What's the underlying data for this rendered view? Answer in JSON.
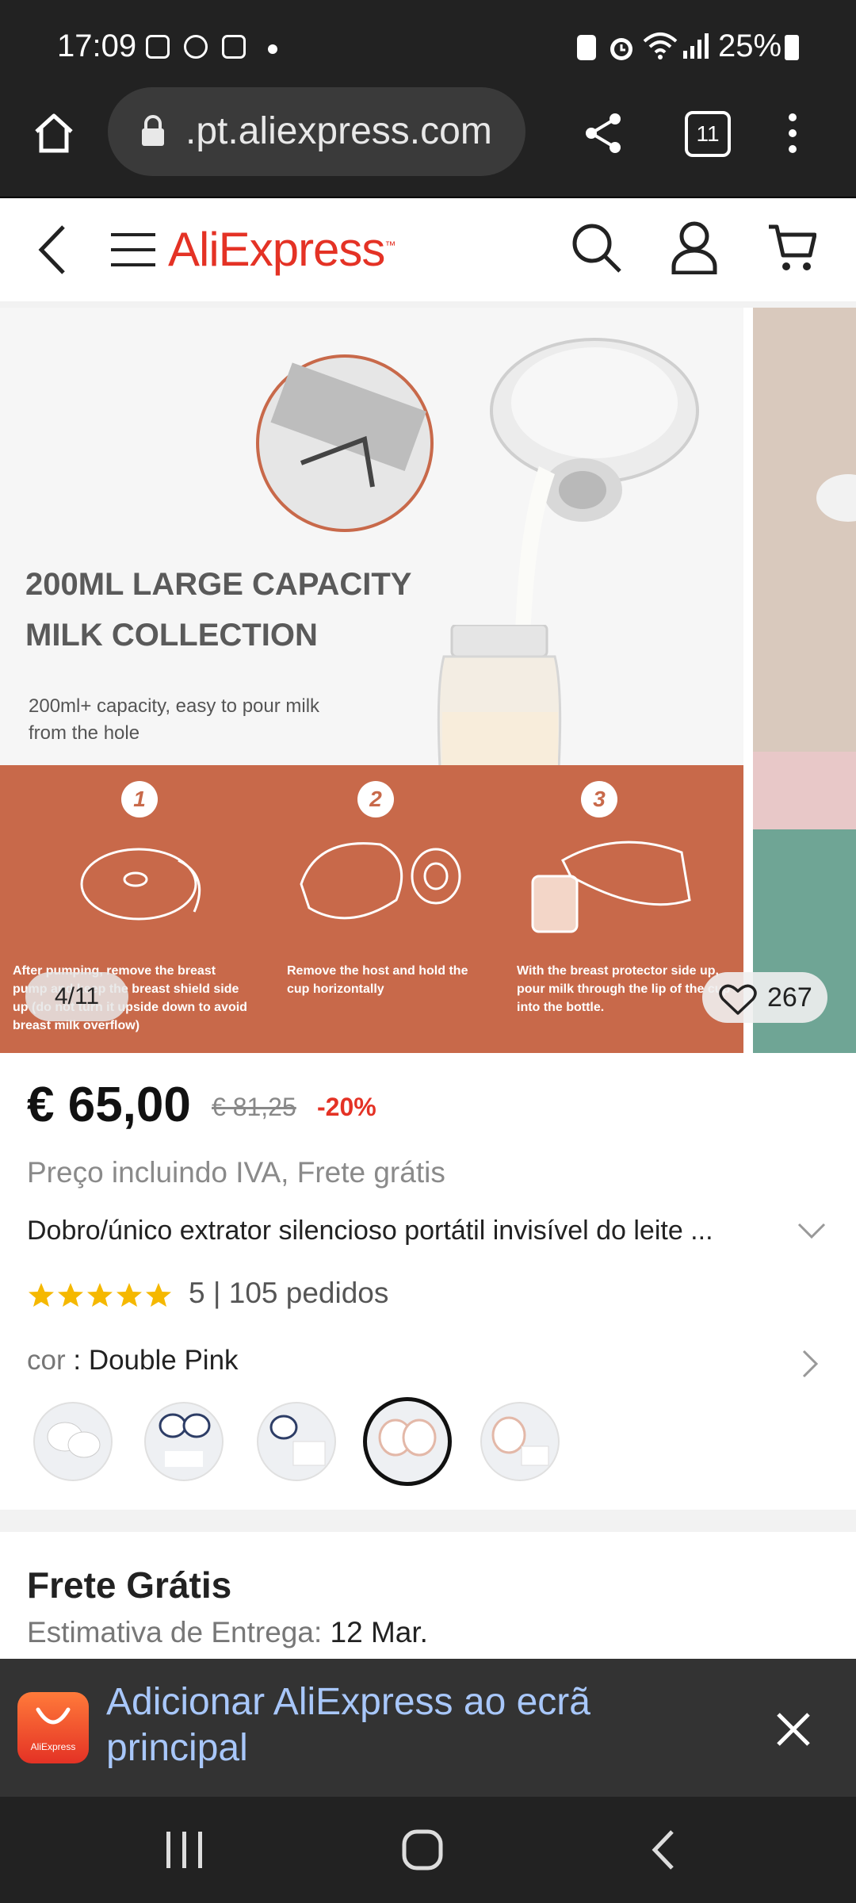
{
  "status_bar": {
    "time": "17:09",
    "battery": "25%"
  },
  "browser": {
    "url": ".pt.aliexpress.com",
    "tab_count": "11"
  },
  "site": {
    "logo": "AliExpress",
    "logo_tm": "™"
  },
  "gallery": {
    "headline_1": "200ML LARGE CAPACITY",
    "headline_2": "MILK COLLECTION",
    "subline": "200ml+ capacity, easy to pour milk from the hole",
    "steps": [
      {
        "num": "1",
        "text": "After pumping, remove the breast pump and keep the breast shield side up (do not turn it upside down to avoid breast milk overflow)"
      },
      {
        "num": "2",
        "text": "Remove the host and hold the cup horizontally"
      },
      {
        "num": "3",
        "text": "With the breast protector side up, pour milk through the lip of the cup into the bottle."
      }
    ],
    "counter": "4/11",
    "wishlist_count": "267"
  },
  "product": {
    "price": "€ 65,00",
    "old_price": "€ 81,25",
    "discount": "-20%",
    "vat_note": "Preço incluindo IVA, Frete grátis",
    "title": "Dobro/único extrator silencioso portátil invisível do leite ...",
    "rating_summary": "5 | 105 pedidos",
    "rating": 5,
    "color_label": "cor",
    "color_value": "Double Pink"
  },
  "shipping": {
    "title": "Frete Grátis",
    "estimate_label": "Estimativa de Entrega:",
    "estimate_value": "12 Mar."
  },
  "banner": {
    "text": "Adicionar AliExpress ao ecrã principal",
    "app_icon_label": "AliExpress"
  },
  "colors": {
    "brand": "#e43225",
    "star": "#f5b800",
    "banner_text": "#a8c7fa"
  }
}
